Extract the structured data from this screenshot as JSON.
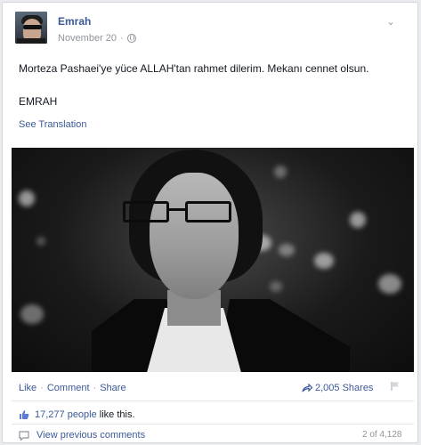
{
  "post": {
    "author": "Emrah",
    "date": "November 20",
    "text": "Morteza Pashaei'ye yüce ALLAH'tan rahmet dilerim. Mekanı cennet olsun.",
    "signature": "EMRAH",
    "see_translation": "See Translation"
  },
  "actions": {
    "like": "Like",
    "comment": "Comment",
    "share": "Share",
    "separator": "·",
    "shares_count": "2,005 Shares"
  },
  "likes": {
    "count": "17,277 people",
    "suffix": "like this."
  },
  "comments": {
    "view_previous": "View previous comments",
    "page_count": "2 of 4,128"
  },
  "colors": {
    "link": "#3b5998",
    "text": "#141823",
    "muted": "#90949c"
  }
}
